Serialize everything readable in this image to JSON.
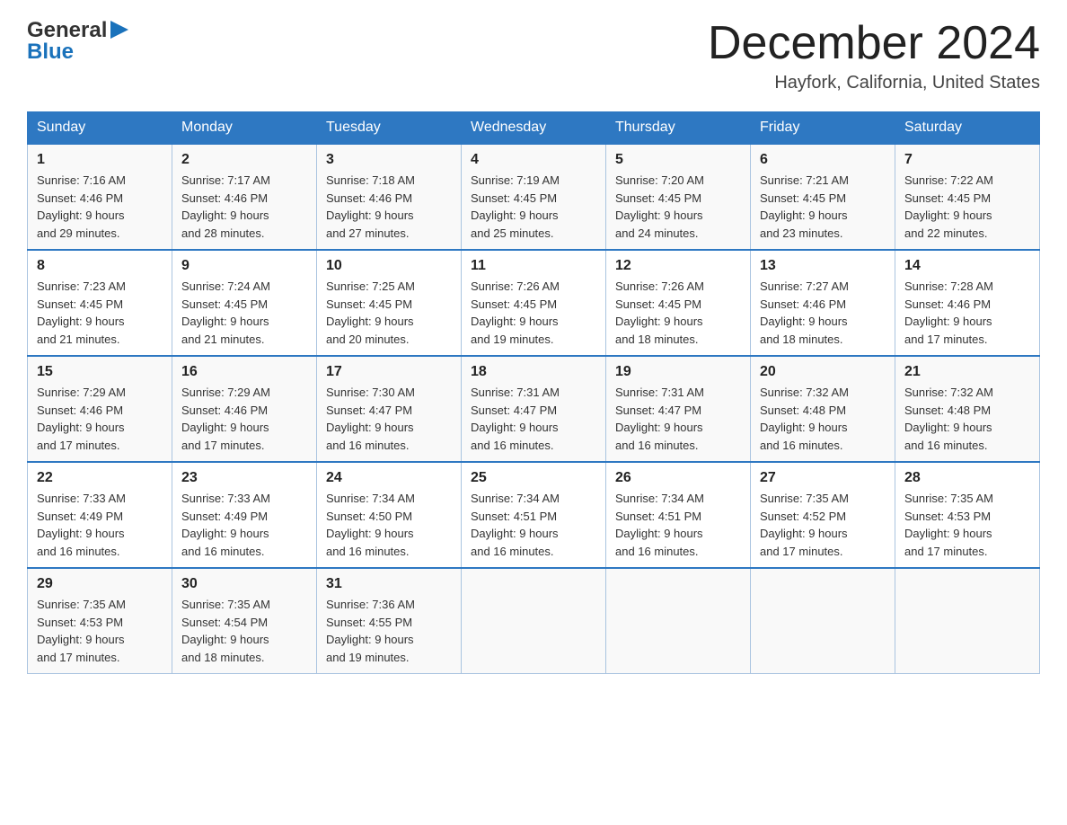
{
  "logo": {
    "line1": "General",
    "arrow": "▶",
    "line2": "Blue"
  },
  "header": {
    "month_year": "December 2024",
    "location": "Hayfork, California, United States"
  },
  "days_of_week": [
    "Sunday",
    "Monday",
    "Tuesday",
    "Wednesday",
    "Thursday",
    "Friday",
    "Saturday"
  ],
  "weeks": [
    [
      {
        "day": "1",
        "sunrise": "7:16 AM",
        "sunset": "4:46 PM",
        "daylight": "9 hours and 29 minutes."
      },
      {
        "day": "2",
        "sunrise": "7:17 AM",
        "sunset": "4:46 PM",
        "daylight": "9 hours and 28 minutes."
      },
      {
        "day": "3",
        "sunrise": "7:18 AM",
        "sunset": "4:46 PM",
        "daylight": "9 hours and 27 minutes."
      },
      {
        "day": "4",
        "sunrise": "7:19 AM",
        "sunset": "4:45 PM",
        "daylight": "9 hours and 25 minutes."
      },
      {
        "day": "5",
        "sunrise": "7:20 AM",
        "sunset": "4:45 PM",
        "daylight": "9 hours and 24 minutes."
      },
      {
        "day": "6",
        "sunrise": "7:21 AM",
        "sunset": "4:45 PM",
        "daylight": "9 hours and 23 minutes."
      },
      {
        "day": "7",
        "sunrise": "7:22 AM",
        "sunset": "4:45 PM",
        "daylight": "9 hours and 22 minutes."
      }
    ],
    [
      {
        "day": "8",
        "sunrise": "7:23 AM",
        "sunset": "4:45 PM",
        "daylight": "9 hours and 21 minutes."
      },
      {
        "day": "9",
        "sunrise": "7:24 AM",
        "sunset": "4:45 PM",
        "daylight": "9 hours and 21 minutes."
      },
      {
        "day": "10",
        "sunrise": "7:25 AM",
        "sunset": "4:45 PM",
        "daylight": "9 hours and 20 minutes."
      },
      {
        "day": "11",
        "sunrise": "7:26 AM",
        "sunset": "4:45 PM",
        "daylight": "9 hours and 19 minutes."
      },
      {
        "day": "12",
        "sunrise": "7:26 AM",
        "sunset": "4:45 PM",
        "daylight": "9 hours and 18 minutes."
      },
      {
        "day": "13",
        "sunrise": "7:27 AM",
        "sunset": "4:46 PM",
        "daylight": "9 hours and 18 minutes."
      },
      {
        "day": "14",
        "sunrise": "7:28 AM",
        "sunset": "4:46 PM",
        "daylight": "9 hours and 17 minutes."
      }
    ],
    [
      {
        "day": "15",
        "sunrise": "7:29 AM",
        "sunset": "4:46 PM",
        "daylight": "9 hours and 17 minutes."
      },
      {
        "day": "16",
        "sunrise": "7:29 AM",
        "sunset": "4:46 PM",
        "daylight": "9 hours and 17 minutes."
      },
      {
        "day": "17",
        "sunrise": "7:30 AM",
        "sunset": "4:47 PM",
        "daylight": "9 hours and 16 minutes."
      },
      {
        "day": "18",
        "sunrise": "7:31 AM",
        "sunset": "4:47 PM",
        "daylight": "9 hours and 16 minutes."
      },
      {
        "day": "19",
        "sunrise": "7:31 AM",
        "sunset": "4:47 PM",
        "daylight": "9 hours and 16 minutes."
      },
      {
        "day": "20",
        "sunrise": "7:32 AM",
        "sunset": "4:48 PM",
        "daylight": "9 hours and 16 minutes."
      },
      {
        "day": "21",
        "sunrise": "7:32 AM",
        "sunset": "4:48 PM",
        "daylight": "9 hours and 16 minutes."
      }
    ],
    [
      {
        "day": "22",
        "sunrise": "7:33 AM",
        "sunset": "4:49 PM",
        "daylight": "9 hours and 16 minutes."
      },
      {
        "day": "23",
        "sunrise": "7:33 AM",
        "sunset": "4:49 PM",
        "daylight": "9 hours and 16 minutes."
      },
      {
        "day": "24",
        "sunrise": "7:34 AM",
        "sunset": "4:50 PM",
        "daylight": "9 hours and 16 minutes."
      },
      {
        "day": "25",
        "sunrise": "7:34 AM",
        "sunset": "4:51 PM",
        "daylight": "9 hours and 16 minutes."
      },
      {
        "day": "26",
        "sunrise": "7:34 AM",
        "sunset": "4:51 PM",
        "daylight": "9 hours and 16 minutes."
      },
      {
        "day": "27",
        "sunrise": "7:35 AM",
        "sunset": "4:52 PM",
        "daylight": "9 hours and 17 minutes."
      },
      {
        "day": "28",
        "sunrise": "7:35 AM",
        "sunset": "4:53 PM",
        "daylight": "9 hours and 17 minutes."
      }
    ],
    [
      {
        "day": "29",
        "sunrise": "7:35 AM",
        "sunset": "4:53 PM",
        "daylight": "9 hours and 17 minutes."
      },
      {
        "day": "30",
        "sunrise": "7:35 AM",
        "sunset": "4:54 PM",
        "daylight": "9 hours and 18 minutes."
      },
      {
        "day": "31",
        "sunrise": "7:36 AM",
        "sunset": "4:55 PM",
        "daylight": "9 hours and 19 minutes."
      },
      null,
      null,
      null,
      null
    ]
  ],
  "labels": {
    "sunrise_prefix": "Sunrise: ",
    "sunset_prefix": "Sunset: ",
    "daylight_prefix": "Daylight: "
  }
}
